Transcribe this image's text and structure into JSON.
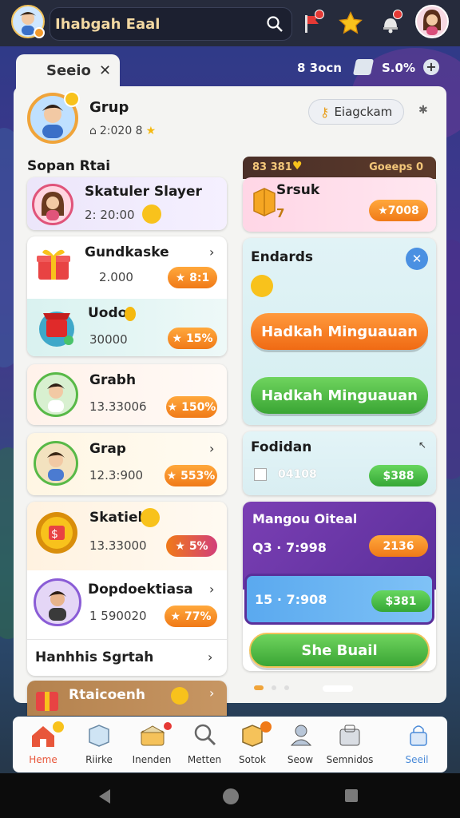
{
  "header": {
    "search_text": "Ihabgah Eaal",
    "stats_left": "8 3ocn",
    "stats_right": "S.0%"
  },
  "tab": {
    "label": "Seeio"
  },
  "profile": {
    "name": "Grup",
    "score": "2:020 8",
    "button": "Eiagckam"
  },
  "section": {
    "title": "Sopan Rtai"
  },
  "list": [
    {
      "title": "Skatuler Slayer",
      "sub": "2: 20:00",
      "badge": ""
    },
    {
      "title": "Gundkaske",
      "sub": "2.000",
      "badge": "★ 8:1"
    },
    {
      "title": "Uodo",
      "sub": "30000",
      "badge": "★ 15%"
    },
    {
      "title": "Grabh",
      "sub": "13.33006",
      "badge": "★ 150%"
    },
    {
      "title": "Grap",
      "sub": "12.3:900",
      "badge": "★ 553%"
    },
    {
      "title": "Skatiel",
      "sub": "13.33000",
      "badge": "★ 5%"
    },
    {
      "title": "Dopdoektiasa",
      "sub": "1 590020",
      "badge": "★ 77%"
    }
  ],
  "list_footer": "Hanhhis Sgrtah",
  "bottom_card": "Rtaicoenh",
  "right": {
    "top_strip_left": "83 381",
    "top_strip_right": "Goeeps 0",
    "pink_title": "Srsuk",
    "pink_sub": "7",
    "pink_badge": "★7008",
    "endards_title": "Endards",
    "btn_orange": "Hadkah Minguauan",
    "btn_green": "Hadkah Minguauan",
    "fodidan_title": "Fodidan",
    "fodidan_sub": "04108",
    "fodidan_badge": "$388",
    "purple_title": "Mangou Oiteal",
    "purple_value": "Q3 · 7:998",
    "purple_badge": "2136",
    "blue_value": "15 · 7:908",
    "blue_badge": "$381",
    "share_button": "She Buail"
  },
  "nav": [
    {
      "label": "Heme"
    },
    {
      "label": "Riirke"
    },
    {
      "label": "Inenden"
    },
    {
      "label": "Metten"
    },
    {
      "label": "Sotok"
    },
    {
      "label": "Seow"
    },
    {
      "label": "Semnidos"
    },
    {
      "label": "Seeil"
    }
  ],
  "colors": {
    "accent_orange": "#f07a18",
    "accent_green": "#35a736",
    "accent_purple": "#6d3fa6",
    "nav_active": "#e8563a"
  },
  "icons": {
    "search": "search-icon",
    "star": "star-icon",
    "home": "home-icon",
    "close": "close-icon"
  }
}
